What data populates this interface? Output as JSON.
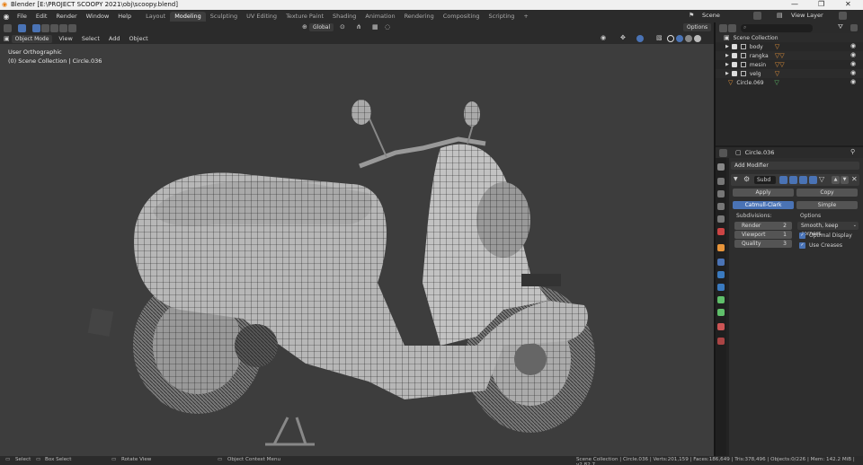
{
  "window": {
    "title": "Blender [E:\\PROJECT SCOOPY 2021\\obj\\scoopy.blend]",
    "minimize": "—",
    "maximize": "❐",
    "close": "✕"
  },
  "menu": {
    "items": [
      "File",
      "Edit",
      "Render",
      "Window",
      "Help"
    ],
    "workspaces": [
      "Layout",
      "Modeling",
      "Sculpting",
      "UV Editing",
      "Texture Paint",
      "Shading",
      "Animation",
      "Rendering",
      "Compositing",
      "Scripting"
    ],
    "active_workspace": "Modeling",
    "add_tab": "+",
    "scene_label": "Scene",
    "view_layer_label": "View Layer"
  },
  "viewport_header": {
    "mode": "Object Mode",
    "menus": [
      "View",
      "Select",
      "Add",
      "Object"
    ],
    "transform_orientation": "Global",
    "options": "Options"
  },
  "viewport": {
    "view_name": "User Orthographic",
    "collection_info": "(0) Scene Collection | Circle.036",
    "model_label": "scoopy"
  },
  "outliner": {
    "search_placeholder": "",
    "root": "Scene Collection",
    "items": [
      {
        "name": "body"
      },
      {
        "name": "rangka"
      },
      {
        "name": "mesin"
      },
      {
        "name": "velg"
      },
      {
        "name": "Circle.069"
      }
    ]
  },
  "properties": {
    "object_name": "Circle.036",
    "add_modifier": "Add Modifier",
    "modifier_name": "Subd",
    "apply": "Apply",
    "copy": "Copy",
    "catmull": "Catmull-Clark",
    "simple": "Simple",
    "subdivisions_label": "Subdivisions:",
    "options_label": "Options",
    "render_label": "Render",
    "render_value": "2",
    "viewport_label": "Viewport",
    "viewport_value": "1",
    "quality_label": "Quality",
    "quality_value": "3",
    "uv_smooth": "Smooth, keep corners",
    "optimal_display": "Optimal Display",
    "use_creases": "Use Creases"
  },
  "statusbar": {
    "select": "Select",
    "box_select": "Box Select",
    "rotate_view": "Rotate View",
    "context_menu": "Object Context Menu",
    "stats": "Scene Collection | Circle.036 | Verts:201,159 | Faces:186,649 | Tris:378,496 | Objects:0/226 | Mem: 142.2 MiB | v2.82.7"
  },
  "colors": {
    "accent": "#4a73b5",
    "viewport_bg": "#3d3d3d",
    "panel_bg": "#2e2e2e",
    "orange": "#e8953a",
    "green": "#5fbf6a"
  }
}
